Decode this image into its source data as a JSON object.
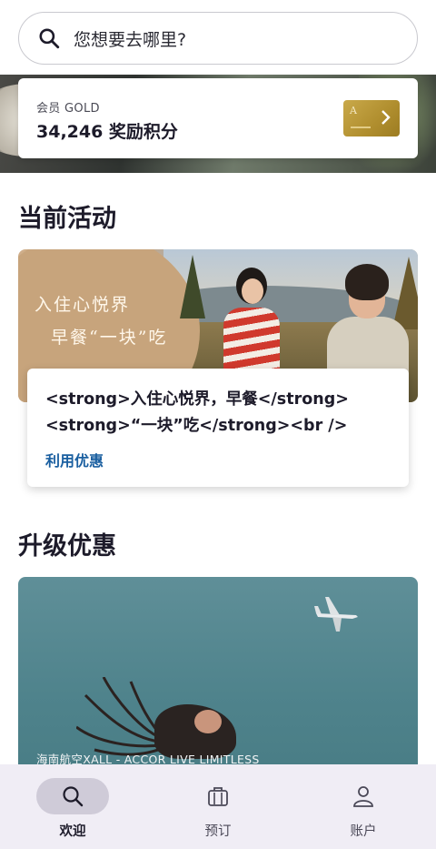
{
  "search": {
    "placeholder": "您想要去哪里?"
  },
  "member": {
    "tier": "会员 GOLD",
    "points": "34,246 奖励积分",
    "card_logo": "A"
  },
  "current_activities": {
    "title": "当前活动",
    "image_text_line1": "入住心悦界",
    "image_text_line2": "早餐“一块”吃",
    "card_title": "<strong>入住心悦界，早餐</strong><strong>“一块”吃</strong><br />",
    "card_link": "利用优惠"
  },
  "upgrades": {
    "title": "升级优惠",
    "caption": "海南航空XALL - ACCOR LIVE LIMITLESS"
  },
  "bottom_nav": [
    {
      "label": "欢迎",
      "icon": "search-icon",
      "active": true
    },
    {
      "label": "预订",
      "icon": "suitcase-icon",
      "active": false
    },
    {
      "label": "账户",
      "icon": "person-icon",
      "active": false
    }
  ],
  "colors": {
    "accent_link": "#1a5fa0",
    "gold": "#b08e2e",
    "nav_bg": "#f0edf5"
  }
}
